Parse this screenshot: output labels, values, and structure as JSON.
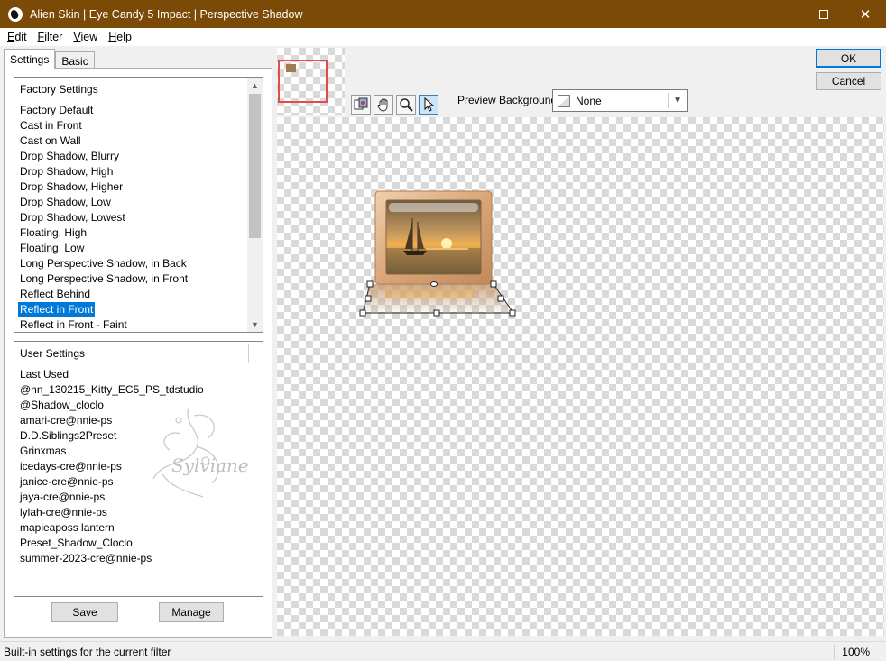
{
  "window": {
    "title": "Alien Skin | Eye Candy 5 Impact | Perspective Shadow",
    "icon": "alien-skin-logo-icon"
  },
  "menu": {
    "items": [
      "Edit",
      "Filter",
      "View",
      "Help"
    ]
  },
  "tabs": [
    "Settings",
    "Basic"
  ],
  "factory_settings": {
    "header": "Factory Settings",
    "items": [
      "Factory Default",
      "Cast in Front",
      "Cast on Wall",
      "Drop Shadow, Blurry",
      "Drop Shadow, High",
      "Drop Shadow, Higher",
      "Drop Shadow, Low",
      "Drop Shadow, Lowest",
      "Floating, High",
      "Floating, Low",
      "Long Perspective Shadow, in Back",
      "Long Perspective Shadow, in Front",
      "Reflect Behind",
      "Reflect in Front",
      "Reflect in Front - Faint"
    ],
    "selected": "Reflect in Front"
  },
  "user_settings": {
    "header": "User Settings",
    "items": [
      "Last Used",
      "@nn_130215_Kitty_EC5_PS_tdstudio",
      "@Shadow_cloclo",
      "amari-cre@nnie-ps",
      "D.D.Siblings2Preset",
      "Grinxmas",
      "icedays-cre@nnie-ps",
      "janice-cre@nnie-ps",
      "jaya-cre@nnie-ps",
      "lylah-cre@nnie-ps",
      "mapieaposs lantern",
      "Preset_Shadow_Cloclo",
      "summer-2023-cre@nnie-ps"
    ]
  },
  "buttons": {
    "save": "Save",
    "manage": "Manage",
    "ok": "OK",
    "cancel": "Cancel"
  },
  "toolbar": {
    "tools": [
      "preview-toggle-icon",
      "hand-icon",
      "zoom-icon",
      "pointer-icon"
    ],
    "active_tool": "pointer-icon"
  },
  "preview_background": {
    "label": "Preview Background:",
    "value": "None"
  },
  "watermark": "Sylviane",
  "status": {
    "text": "Built-in settings for the current filter",
    "zoom": "100%"
  }
}
